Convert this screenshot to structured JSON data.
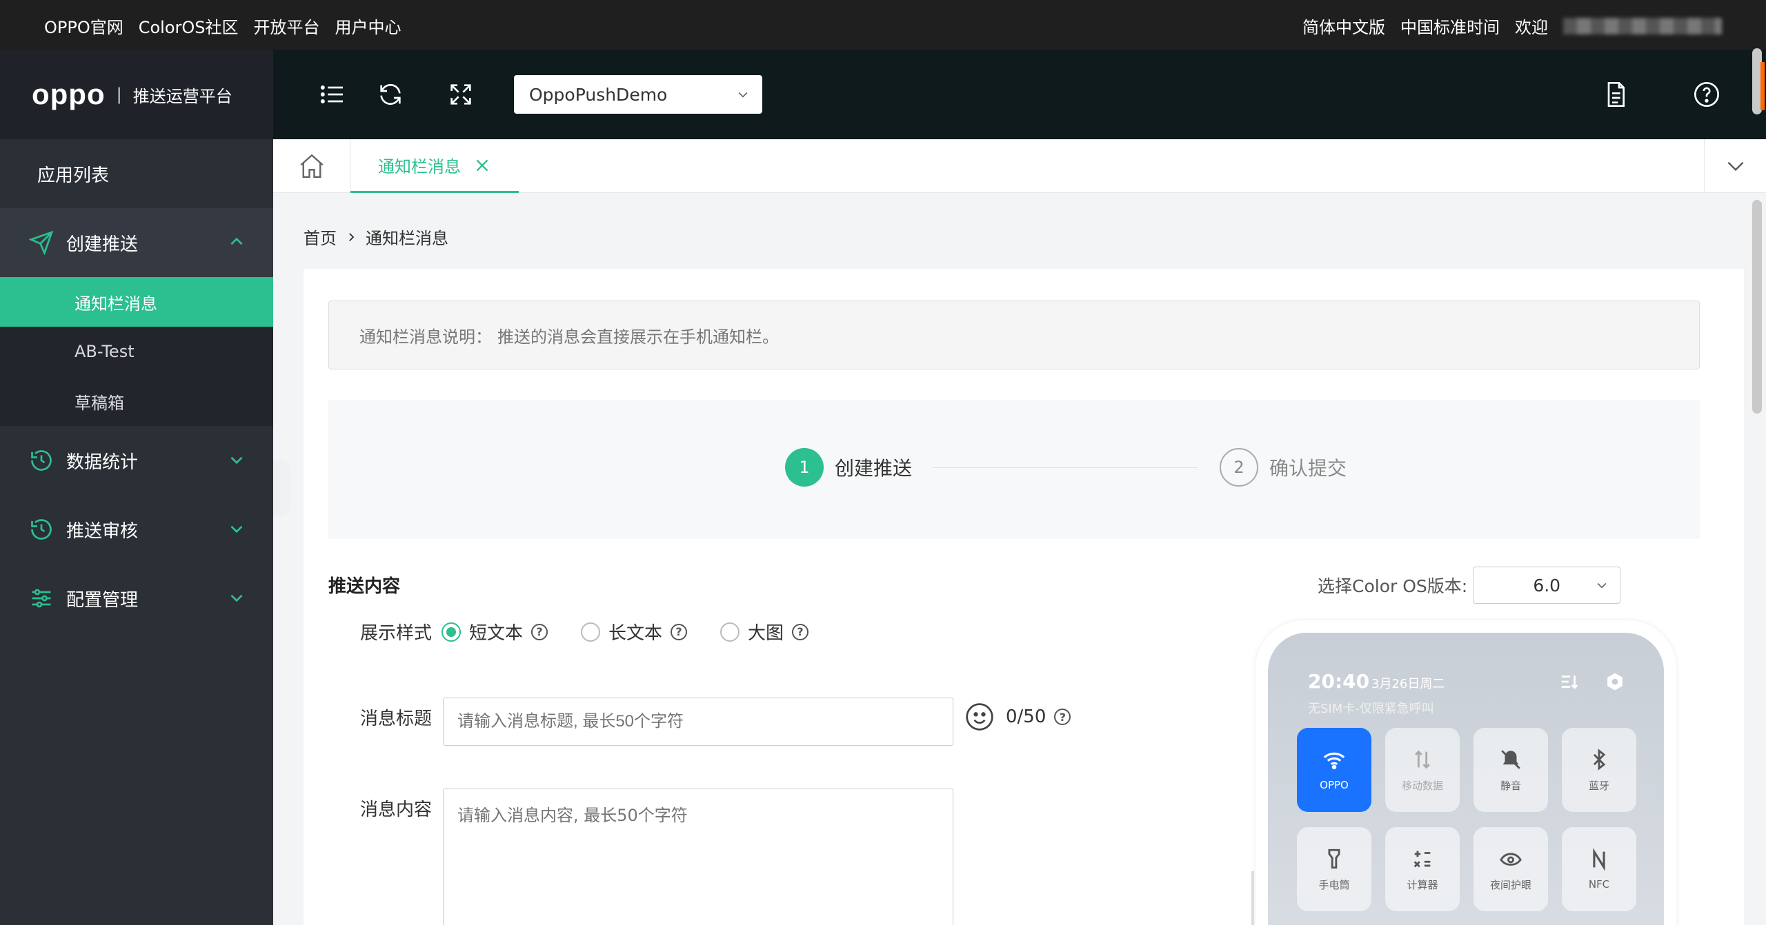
{
  "topbar": {
    "links": [
      "OPPO官网",
      "ColorOS社区",
      "开放平台",
      "用户中心"
    ],
    "language": "简体中文版",
    "timezone": "中国标准时间",
    "welcome": "欢迎"
  },
  "brand": {
    "logo": "oppo",
    "platform": "推送运营平台"
  },
  "sidebar": {
    "app_list": "应用列表",
    "groups": [
      {
        "label": "创建推送",
        "icon": "send-icon",
        "expanded": true,
        "items": [
          {
            "label": "通知栏消息",
            "active": true
          },
          {
            "label": "AB-Test"
          },
          {
            "label": "草稿箱"
          }
        ]
      },
      {
        "label": "数据统计",
        "icon": "history-icon"
      },
      {
        "label": "推送审核",
        "icon": "history-icon"
      },
      {
        "label": "配置管理",
        "icon": "sliders-icon"
      }
    ]
  },
  "header": {
    "app_select": "OppoPushDemo"
  },
  "tabs": {
    "active": "通知栏消息"
  },
  "breadcrumb": {
    "home": "首页",
    "current": "通知栏消息"
  },
  "notice": {
    "label": "通知栏消息说明：",
    "text": "推送的消息会直接展示在手机通知栏。"
  },
  "steps": [
    {
      "num": "1",
      "label": "创建推送"
    },
    {
      "num": "2",
      "label": "确认提交"
    }
  ],
  "form": {
    "section_title": "推送内容",
    "style_label": "展示样式",
    "styles": [
      "短文本",
      "长文本",
      "大图"
    ],
    "selected_style": "短文本",
    "title_label": "消息标题",
    "title_placeholder": "请输入消息标题, 最长50个字符",
    "title_counter": "0/50",
    "content_label": "消息内容",
    "content_placeholder": "请输入消息内容, 最长50个字符"
  },
  "preview": {
    "os_label": "选择Color OS版本:",
    "os_version": "6.0",
    "time": "20:40",
    "date": "3月26日周二",
    "sim": "无SIM卡-仅限紧急呼叫",
    "tiles": [
      "OPPO",
      "移动数据",
      "静音",
      "蓝牙",
      "手电筒",
      "计算器",
      "夜间护眼",
      "NFC"
    ]
  },
  "colors": {
    "accent": "#2cbf8f",
    "sidebar": "#2b2f36",
    "header": "#0e1a1c",
    "wifi_tile": "#1a73ff"
  }
}
